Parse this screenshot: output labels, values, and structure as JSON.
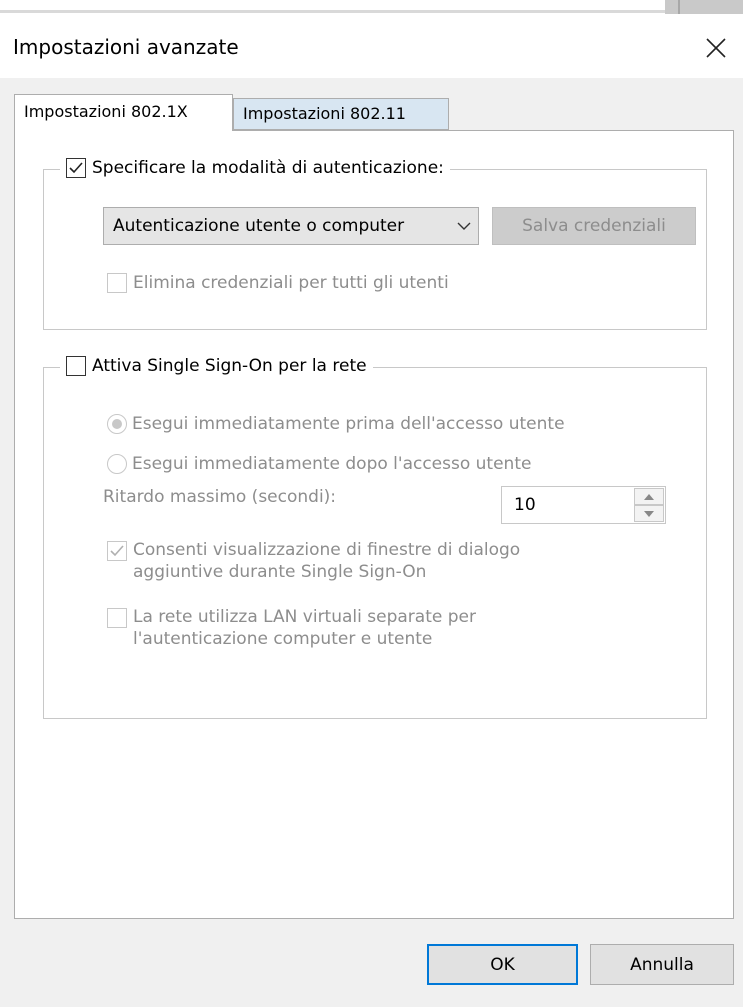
{
  "window": {
    "title": "Impostazioni avanzate"
  },
  "tabs": [
    {
      "label": "Impostazioni 802.1X"
    },
    {
      "label": "Impostazioni 802.11"
    }
  ],
  "auth_group": {
    "specify_mode_label": "Specificare la modalità di autenticazione:",
    "specify_mode_checked": true,
    "auth_mode_selected": "Autenticazione utente o computer",
    "save_credentials_label": "Salva credenziali",
    "delete_credentials_label": "Elimina credenziali per tutti gli utenti",
    "delete_credentials_checked": false
  },
  "sso_group": {
    "enable_sso_label": "Attiva Single Sign-On per la rete",
    "enable_sso_checked": false,
    "before_logon_label": "Esegui immediatamente prima dell'accesso utente",
    "before_logon_selected": true,
    "after_logon_label": "Esegui immediatamente dopo l'accesso utente",
    "max_delay_label": "Ritardo massimo (secondi):",
    "max_delay_value": "10",
    "allow_dialogs_label_line1": "Consenti visualizzazione di finestre di dialogo",
    "allow_dialogs_label_line2": "aggiuntive durante Single Sign-On",
    "allow_dialogs_checked": true,
    "vlan_label_line1": "La rete utilizza LAN virtuali separate per",
    "vlan_label_line2": "l'autenticazione computer e utente",
    "vlan_checked": false
  },
  "footer": {
    "ok_label": "OK",
    "cancel_label": "Annulla"
  }
}
